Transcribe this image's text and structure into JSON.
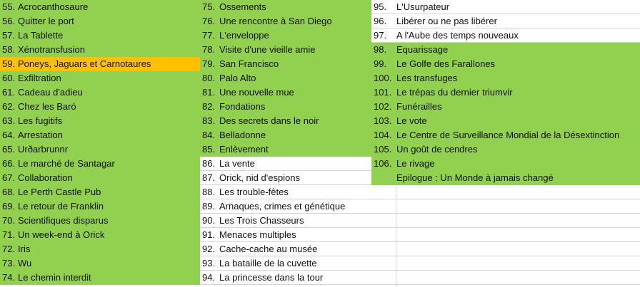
{
  "colors": {
    "green": "#92d050",
    "orange": "#ffc000",
    "white": "#ffffff",
    "grid": "#d4d4d4"
  },
  "columns": [
    {
      "rows": [
        {
          "num": "55.",
          "title": "Acrocanthosaure",
          "fill": "green"
        },
        {
          "num": "56.",
          "title": "Quitter le port",
          "fill": "green"
        },
        {
          "num": "57.",
          "title": "La Tablette",
          "fill": "green"
        },
        {
          "num": "58.",
          "title": "Xénotransfusion",
          "fill": "green"
        },
        {
          "num": "59.",
          "title": "Poneys, Jaguars et Carnotaures",
          "fill": "orange"
        },
        {
          "num": "60.",
          "title": "Exfiltration",
          "fill": "green"
        },
        {
          "num": "61.",
          "title": "Cadeau d'adieu",
          "fill": "green"
        },
        {
          "num": "62.",
          "title": "Chez les Baró",
          "fill": "green"
        },
        {
          "num": "63.",
          "title": "Les fugitifs",
          "fill": "green"
        },
        {
          "num": "64.",
          "title": "Arrestation",
          "fill": "green"
        },
        {
          "num": "65.",
          "title": "Urðarbrunnr",
          "fill": "green"
        },
        {
          "num": "66.",
          "title": "Le marché de Santagar",
          "fill": "green"
        },
        {
          "num": "67.",
          "title": "Collaboration",
          "fill": "green"
        },
        {
          "num": "68.",
          "title": "Le Perth Castle Pub",
          "fill": "green"
        },
        {
          "num": "69.",
          "title": "Le retour de Franklin",
          "fill": "green"
        },
        {
          "num": "70.",
          "title": "Scientifiques disparus",
          "fill": "green"
        },
        {
          "num": "71.",
          "title": "Un week-end à Orick",
          "fill": "green"
        },
        {
          "num": "72.",
          "title": "Iris",
          "fill": "green"
        },
        {
          "num": "73.",
          "title": "Wu",
          "fill": "green"
        },
        {
          "num": "74.",
          "title": "Le chemin interdit",
          "fill": "green"
        }
      ]
    },
    {
      "rows": [
        {
          "num": "75.",
          "title": "Ossements",
          "fill": "green"
        },
        {
          "num": "76.",
          "title": "Une rencontre à San Diego",
          "fill": "green"
        },
        {
          "num": "77.",
          "title": "L'enveloppe",
          "fill": "green"
        },
        {
          "num": "78.",
          "title": "Visite d'une vieille amie",
          "fill": "green"
        },
        {
          "num": "79.",
          "title": "San Francisco",
          "fill": "green"
        },
        {
          "num": "80.",
          "title": "Palo Alto",
          "fill": "green"
        },
        {
          "num": "81.",
          "title": "Une nouvelle mue",
          "fill": "green"
        },
        {
          "num": "82.",
          "title": "Fondations",
          "fill": "green"
        },
        {
          "num": "83.",
          "title": "Des secrets dans le noir",
          "fill": "green"
        },
        {
          "num": "84.",
          "title": "Belladonne",
          "fill": "green"
        },
        {
          "num": "85.",
          "title": "Enlèvement",
          "fill": "green"
        },
        {
          "num": "86.",
          "title": "La vente",
          "fill": "white"
        },
        {
          "num": "87.",
          "title": "Orick, nid d'espions",
          "fill": "white"
        },
        {
          "num": "88.",
          "title": "Les trouble-fêtes",
          "fill": "white"
        },
        {
          "num": "89.",
          "title": "Arnaques, crimes et génétique",
          "fill": "white"
        },
        {
          "num": "90.",
          "title": "Les Trois Chasseurs",
          "fill": "white"
        },
        {
          "num": "91.",
          "title": "Menaces multiples",
          "fill": "white"
        },
        {
          "num": "92.",
          "title": "Cache-cache au musée",
          "fill": "white"
        },
        {
          "num": "93.",
          "title": "La bataille de la cuvette",
          "fill": "white"
        },
        {
          "num": "94.",
          "title": "La princesse dans la tour",
          "fill": "white"
        }
      ]
    },
    {
      "rows": [
        {
          "num": "95.",
          "title": "L'Usurpateur",
          "fill": "white"
        },
        {
          "num": "96.",
          "title": "Libérer ou ne pas libérer",
          "fill": "white"
        },
        {
          "num": "97.",
          "title": "A l'Aube des temps nouveaux",
          "fill": "white"
        },
        {
          "num": "98.",
          "title": "Equarissage",
          "fill": "green"
        },
        {
          "num": "99.",
          "title": "Le Golfe des Farallones",
          "fill": "green"
        },
        {
          "num": "100.",
          "title": "Les transfuges",
          "fill": "green"
        },
        {
          "num": "101.",
          "title": "Le trépas du dernier triumvir",
          "fill": "green"
        },
        {
          "num": "102.",
          "title": "Funérailles",
          "fill": "green"
        },
        {
          "num": "103.",
          "title": "Le vote",
          "fill": "green"
        },
        {
          "num": "104.",
          "title": "Le Centre de Surveillance Mondial de la Désextinction",
          "fill": "green"
        },
        {
          "num": "105.",
          "title": "Un goût de cendres",
          "fill": "green"
        },
        {
          "num": "106.",
          "title": "Le rivage",
          "fill": "green"
        },
        {
          "num": "",
          "title": "Epilogue : Un Monde à jamais changé",
          "fill": "green"
        }
      ]
    }
  ]
}
